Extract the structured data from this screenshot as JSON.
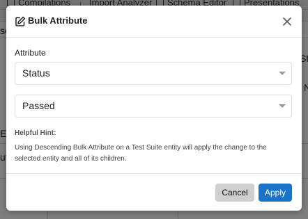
{
  "background": {
    "nav": [
      "Compilations",
      "Import Analyzer",
      "Schema Editor",
      "Presentations"
    ],
    "left_fragments": [
      "se",
      "E",
      "ut"
    ],
    "right_fragments": [
      "St",
      "N"
    ]
  },
  "modal": {
    "title": "Bulk Attribute",
    "attribute_label": "Attribute",
    "attribute_select": {
      "value": "Status"
    },
    "value_select": {
      "value": "Passed"
    },
    "hint_title": "Helpful Hint:",
    "hint_text": "Using Descending Bulk Attribute on a Test Suite entity will apply the change to the selected entity and all of its children.",
    "cancel_label": "Cancel",
    "apply_label": "Apply"
  },
  "colors": {
    "apply_button": "#1a73c8",
    "cancel_button": "#cfcfcf"
  }
}
